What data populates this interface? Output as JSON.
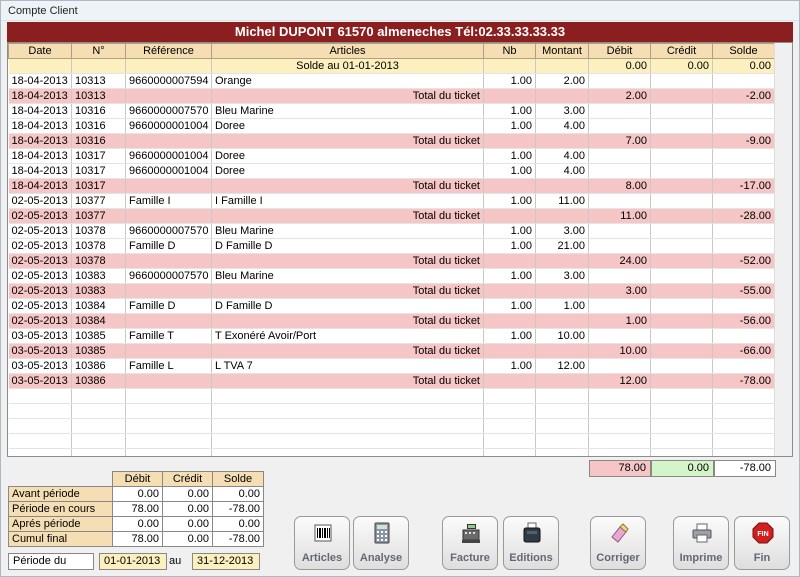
{
  "window": {
    "title": "Compte Client"
  },
  "banner": {
    "text": "Michel DUPONT 61570 almeneches  Tél:02.33.33.33.33"
  },
  "grid": {
    "columns": [
      "Date",
      "N°",
      "Référence",
      "Articles",
      "Nb",
      "Montant",
      "Débit",
      "Crédit",
      "Solde"
    ],
    "rows": [
      {
        "type": "solde",
        "date": "",
        "num": "",
        "ref": "",
        "article": "Solde au 01-01-2013",
        "nb": "",
        "montant": "",
        "debit": "0.00",
        "credit": "0.00",
        "solde": "0.00"
      },
      {
        "type": "item",
        "date": "18-04-2013",
        "num": "10313",
        "ref": "9660000007594",
        "article": "Orange",
        "nb": "1.00",
        "montant": "2.00",
        "debit": "",
        "credit": "",
        "solde": ""
      },
      {
        "type": "total",
        "date": "18-04-2013",
        "num": "10313",
        "ref": "",
        "article": "Total du ticket",
        "nb": "",
        "montant": "",
        "debit": "2.00",
        "credit": "",
        "solde": "-2.00"
      },
      {
        "type": "item",
        "date": "18-04-2013",
        "num": "10316",
        "ref": "9660000007570",
        "article": "Bleu Marine",
        "nb": "1.00",
        "montant": "3.00",
        "debit": "",
        "credit": "",
        "solde": ""
      },
      {
        "type": "item",
        "date": "18-04-2013",
        "num": "10316",
        "ref": "9660000001004",
        "article": "Doree",
        "nb": "1.00",
        "montant": "4.00",
        "debit": "",
        "credit": "",
        "solde": ""
      },
      {
        "type": "total",
        "date": "18-04-2013",
        "num": "10316",
        "ref": "",
        "article": "Total du ticket",
        "nb": "",
        "montant": "",
        "debit": "7.00",
        "credit": "",
        "solde": "-9.00"
      },
      {
        "type": "item",
        "date": "18-04-2013",
        "num": "10317",
        "ref": "9660000001004",
        "article": "Doree",
        "nb": "1.00",
        "montant": "4.00",
        "debit": "",
        "credit": "",
        "solde": ""
      },
      {
        "type": "item",
        "date": "18-04-2013",
        "num": "10317",
        "ref": "9660000001004",
        "article": "Doree",
        "nb": "1.00",
        "montant": "4.00",
        "debit": "",
        "credit": "",
        "solde": ""
      },
      {
        "type": "total",
        "date": "18-04-2013",
        "num": "10317",
        "ref": "",
        "article": "Total du ticket",
        "nb": "",
        "montant": "",
        "debit": "8.00",
        "credit": "",
        "solde": "-17.00"
      },
      {
        "type": "item",
        "date": "02-05-2013",
        "num": "10377",
        "ref": "Famille I",
        "article": "I Famille I",
        "nb": "1.00",
        "montant": "11.00",
        "debit": "",
        "credit": "",
        "solde": ""
      },
      {
        "type": "total",
        "date": "02-05-2013",
        "num": "10377",
        "ref": "",
        "article": "Total du ticket",
        "nb": "",
        "montant": "",
        "debit": "11.00",
        "credit": "",
        "solde": "-28.00"
      },
      {
        "type": "item",
        "date": "02-05-2013",
        "num": "10378",
        "ref": "9660000007570",
        "article": "Bleu Marine",
        "nb": "1.00",
        "montant": "3.00",
        "debit": "",
        "credit": "",
        "solde": ""
      },
      {
        "type": "item",
        "date": "02-05-2013",
        "num": "10378",
        "ref": "Famille D",
        "article": "D Famille D",
        "nb": "1.00",
        "montant": "21.00",
        "debit": "",
        "credit": "",
        "solde": ""
      },
      {
        "type": "total",
        "date": "02-05-2013",
        "num": "10378",
        "ref": "",
        "article": "Total du ticket",
        "nb": "",
        "montant": "",
        "debit": "24.00",
        "credit": "",
        "solde": "-52.00"
      },
      {
        "type": "item",
        "date": "02-05-2013",
        "num": "10383",
        "ref": "9660000007570",
        "article": "Bleu Marine",
        "nb": "1.00",
        "montant": "3.00",
        "debit": "",
        "credit": "",
        "solde": ""
      },
      {
        "type": "total",
        "date": "02-05-2013",
        "num": "10383",
        "ref": "",
        "article": "Total du ticket",
        "nb": "",
        "montant": "",
        "debit": "3.00",
        "credit": "",
        "solde": "-55.00"
      },
      {
        "type": "item",
        "date": "02-05-2013",
        "num": "10384",
        "ref": "Famille D",
        "article": "D Famille D",
        "nb": "1.00",
        "montant": "1.00",
        "debit": "",
        "credit": "",
        "solde": ""
      },
      {
        "type": "total",
        "date": "02-05-2013",
        "num": "10384",
        "ref": "",
        "article": "Total du ticket",
        "nb": "",
        "montant": "",
        "debit": "1.00",
        "credit": "",
        "solde": "-56.00"
      },
      {
        "type": "item",
        "date": "03-05-2013",
        "num": "10385",
        "ref": "Famille T",
        "article": "T Exonéré Avoir/Port",
        "nb": "1.00",
        "montant": "10.00",
        "debit": "",
        "credit": "",
        "solde": ""
      },
      {
        "type": "total",
        "date": "03-05-2013",
        "num": "10385",
        "ref": "",
        "article": "Total du ticket",
        "nb": "",
        "montant": "",
        "debit": "10.00",
        "credit": "",
        "solde": "-66.00"
      },
      {
        "type": "item",
        "date": "03-05-2013",
        "num": "10386",
        "ref": "Famille L",
        "article": "L TVA 7",
        "nb": "1.00",
        "montant": "12.00",
        "debit": "",
        "credit": "",
        "solde": ""
      },
      {
        "type": "total",
        "date": "03-05-2013",
        "num": "10386",
        "ref": "",
        "article": "Total du ticket",
        "nb": "",
        "montant": "",
        "debit": "12.00",
        "credit": "",
        "solde": "-78.00"
      }
    ]
  },
  "totals": {
    "debit": "78.00",
    "credit": "0.00",
    "solde": "-78.00"
  },
  "summary": {
    "columns": [
      "Débit",
      "Crédit",
      "Solde"
    ],
    "rows": [
      {
        "label": "Avant période",
        "debit": "0.00",
        "credit": "0.00",
        "solde": "0.00"
      },
      {
        "label": "Période en cours",
        "debit": "78.00",
        "credit": "0.00",
        "solde": "-78.00"
      },
      {
        "label": "Aprés période",
        "debit": "0.00",
        "credit": "0.00",
        "solde": "0.00"
      },
      {
        "label": "Cumul final",
        "debit": "78.00",
        "credit": "0.00",
        "solde": "-78.00"
      }
    ]
  },
  "period": {
    "label": "Période du",
    "from": "01-01-2013",
    "to_label": "au",
    "to": "31-12-2013"
  },
  "buttons": [
    {
      "id": "articles",
      "label": "Articles",
      "icon": "barcode-icon"
    },
    {
      "id": "analyse",
      "label": "Analyse",
      "icon": "calculator-icon"
    },
    {
      "id": "facture",
      "label": "Facture",
      "icon": "cash-register-icon"
    },
    {
      "id": "editions",
      "label": "Editions",
      "icon": "receipt-printer-icon"
    },
    {
      "id": "corriger",
      "label": "Corriger",
      "icon": "eraser-icon"
    },
    {
      "id": "imprime",
      "label": "Imprime",
      "icon": "printer-icon"
    },
    {
      "id": "fin",
      "label": "Fin",
      "icon": "stop-sign-icon",
      "icon_text": "FIN"
    }
  ],
  "colors": {
    "banner": "#8b1f1f",
    "header": "#f5deb3",
    "total_row": "#f6c6c6",
    "solde_row": "#fcf0bf",
    "debit_total": "#f6c6c6",
    "credit_total": "#d4f5c8"
  }
}
